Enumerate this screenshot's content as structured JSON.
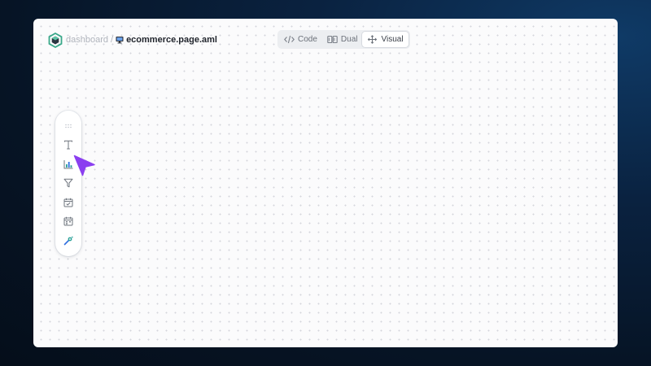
{
  "breadcrumb": {
    "root": "dashboard",
    "separator": "/",
    "file_icon": "monitor-icon",
    "file": "ecommerce.page.aml"
  },
  "view_toggle": {
    "options": [
      {
        "label": "Code",
        "icon": "code-icon"
      },
      {
        "label": "Dual",
        "icon": "split-columns-icon"
      },
      {
        "label": "Visual",
        "icon": "move-arrows-icon"
      }
    ],
    "selected": "Visual"
  },
  "toolbar": {
    "tools": [
      "drag-handle-icon",
      "text-icon",
      "bar-chart-icon",
      "filter-icon",
      "calendar-icon",
      "date-range-icon",
      "magic-wand-icon"
    ]
  },
  "colors": {
    "background": "#061425",
    "canvas": "#fbfbfc",
    "logo_green": "#3aa88a",
    "cursor_purple": "#8b3ff0",
    "chart_teal": "#2aa198",
    "chart_blue": "#2f6fe0"
  }
}
